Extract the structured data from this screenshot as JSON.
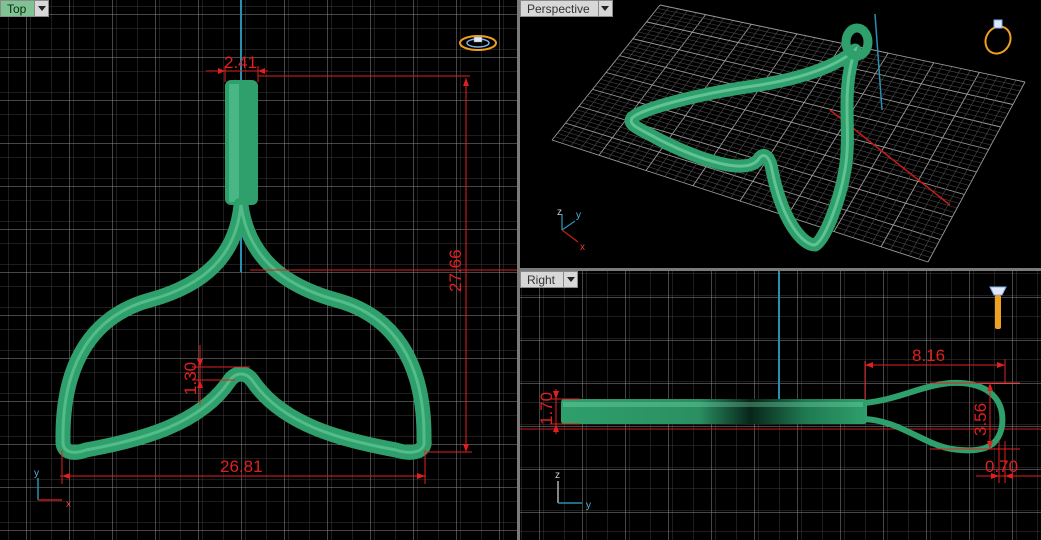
{
  "viewports": {
    "top": {
      "label": "Top"
    },
    "perspective": {
      "label": "Perspective"
    },
    "right": {
      "label": "Right"
    }
  },
  "dimensions": {
    "top": {
      "width_loop": "2.41",
      "height": "27.66",
      "notch": "1.30",
      "width_tail": "26.81"
    },
    "right": {
      "length_loop": "8.16",
      "thickness": "1.70",
      "loop_height": "3.56",
      "wire": "0.70"
    }
  },
  "axes": {
    "top": {
      "v": "y",
      "h": "x"
    },
    "perspective": {
      "z": "z",
      "y": "y",
      "x": "x"
    },
    "right": {
      "v": "z",
      "h": "y"
    }
  },
  "colors": {
    "model": "#2f9f6c",
    "grid_major": "#8c8c8c",
    "grid_minor": "#3a3a3a",
    "dimension": "#e02020",
    "axis_y": "#2a8fb0",
    "axis_x": "#c81a1a",
    "tab_active": "#7fc393",
    "tab_inactive": "#d8d8d8"
  },
  "icons": [
    "ring-widget-icon",
    "axis-triad-icon",
    "viewport-menu-icon"
  ]
}
